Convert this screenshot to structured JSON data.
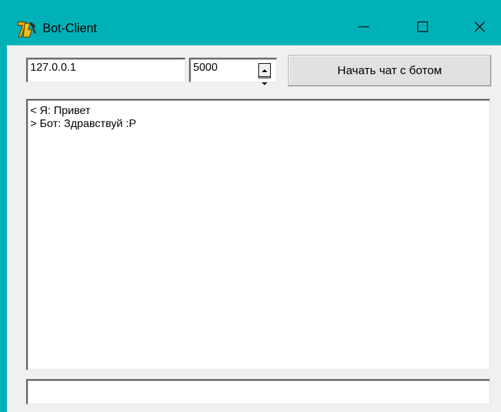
{
  "window": {
    "title": "Bot-Client",
    "icon": "delphi-app-icon",
    "controls": {
      "minimize": "minimize-icon",
      "maximize": "maximize-icon",
      "close": "close-icon"
    }
  },
  "connection": {
    "ip_value": "127.0.0.1",
    "port_value": "5000",
    "start_button_label": "Начать чат с ботом"
  },
  "chat": {
    "lines": [
      "< Я: Привет",
      "> Бот: Здравствуй :P"
    ]
  },
  "message_input": {
    "value": ""
  },
  "colors": {
    "titlebar": "#00b2b8",
    "client_background": "#f0f0f0"
  }
}
